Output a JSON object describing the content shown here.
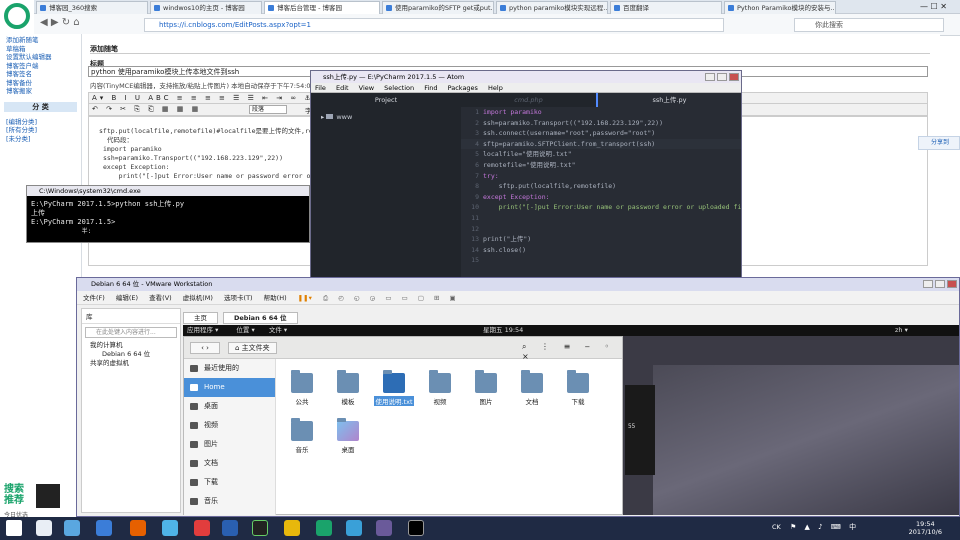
{
  "browser": {
    "tabs": [
      {
        "label": "博客园_360搜索"
      },
      {
        "label": "windwos10的主页 - 博客园"
      },
      {
        "label": "博客后台管理 - 博客园"
      },
      {
        "label": "使用paramiko的SFTP get或put..."
      },
      {
        "label": "python paramiko模块实现远程..."
      },
      {
        "label": "百度翻译"
      },
      {
        "label": "Python Paramiko模块的安装与..."
      }
    ],
    "url": "https://i.cnblogs.com/EditPosts.aspx?opt=1",
    "search_placeholder": "你此搜索"
  },
  "blog": {
    "nav_links": [
      "添加新随笔",
      "草稿箱",
      "设置默认编辑器",
      "博客签户端",
      "博客签名",
      "博客备份",
      "博客搬家"
    ],
    "category_header": "分 类",
    "categories": [
      "[编辑分类]",
      "[所有分类]",
      "[未分类]"
    ],
    "section_title": "添加随笔",
    "title_label": "标题",
    "title_value": "python 使用paramiko模块上传本地文件到ssh",
    "content_label": "内容(TinyMCE编辑器，支持拖放/粘贴上传图片)  本地自动保存于下午7:54:00，查看",
    "format_select": "段落",
    "font_label": "字体",
    "editor_lines": [
      "sftp.put(localfile,remotefile)#localfile是要上传的文件,remotefile是...",
      "",
      "代码段：",
      "",
      "import paramiko",
      "ssh=paramiko.Transport((\"192.168.223.129\",22))",
      "",
      "",
      "",
      "except Exception:",
      "    print(\"[-]put Error:User name or password error or uploaded file does not exist\")"
    ],
    "share_label": "分享到",
    "ad_title": "搜索推荐",
    "ad_hint": "今日优选"
  },
  "cmd": {
    "title": "C:\\Windows\\system32\\cmd.exe",
    "lines": [
      "E:\\PyCharm 2017.1.5>python ssh上传.py",
      "上传",
      "",
      "E:\\PyCharm 2017.1.5>",
      "              半:"
    ]
  },
  "atom": {
    "title": "ssh上传.py — E:\\PyCharm 2017.1.5 — Atom",
    "menu": [
      "File",
      "Edit",
      "View",
      "Selection",
      "Find",
      "Packages",
      "Help"
    ],
    "tabs": [
      "Project",
      "cmd.php",
      "ssh上传.py"
    ],
    "folder": "www",
    "code": [
      {
        "n": "1",
        "t": "import paramiko"
      },
      {
        "n": "2",
        "t": "ssh=paramiko.Transport((\"192.168.223.129\",22))"
      },
      {
        "n": "3",
        "t": "ssh.connect(username=\"root\",password=\"root\")"
      },
      {
        "n": "4",
        "t": "sftp=paramiko.SFTPClient.from_transport(ssh)"
      },
      {
        "n": "5",
        "t": "localfile=\"使用说明.txt\""
      },
      {
        "n": "6",
        "t": "remotefile=\"使用说明.txt\""
      },
      {
        "n": "7",
        "t": "try:"
      },
      {
        "n": "8",
        "t": "    sftp.put(localfile,remotefile)"
      },
      {
        "n": "9",
        "t": "except Exception:"
      },
      {
        "n": "10",
        "t": "    print(\"[-]put Error:User name or password error or uploaded fi"
      },
      {
        "n": "11",
        "t": ""
      },
      {
        "n": "12",
        "t": ""
      },
      {
        "n": "13",
        "t": "print(\"上传\")"
      },
      {
        "n": "14",
        "t": "ssh.close()"
      },
      {
        "n": "15",
        "t": ""
      }
    ]
  },
  "vmware": {
    "title": "Debian 6 64 位 - VMware Workstation",
    "menu": [
      "文件(F)",
      "编辑(E)",
      "查看(V)",
      "虚拟机(M)",
      "选项卡(T)",
      "帮助(H)"
    ],
    "library_title": "库",
    "library_search": "在此处键入内容进行...",
    "tree": [
      "我的计算机",
      "Debian 6 64 位",
      "共享的虚拟机"
    ],
    "tabs": [
      "主页",
      "Debian 6 64 位"
    ],
    "guest_bar": {
      "apps": "应用程序 ▾",
      "places": "位置 ▾",
      "files": "文件 ▾",
      "clock": "星期五 19:54",
      "lang": "zh ▾"
    },
    "nautilus": {
      "location": "主文件夹",
      "sidebar": [
        "最近使用的",
        "Home",
        "桌面",
        "视频",
        "图片",
        "文档",
        "下载",
        "音乐"
      ],
      "files": [
        "公共",
        "模板",
        "使用说明.txt",
        "视频",
        "图片",
        "文档",
        "下载",
        "音乐",
        "桌面"
      ]
    }
  },
  "taskbar": {
    "time": "19:54",
    "date": "2017/10/6",
    "tray_text": "CK"
  }
}
